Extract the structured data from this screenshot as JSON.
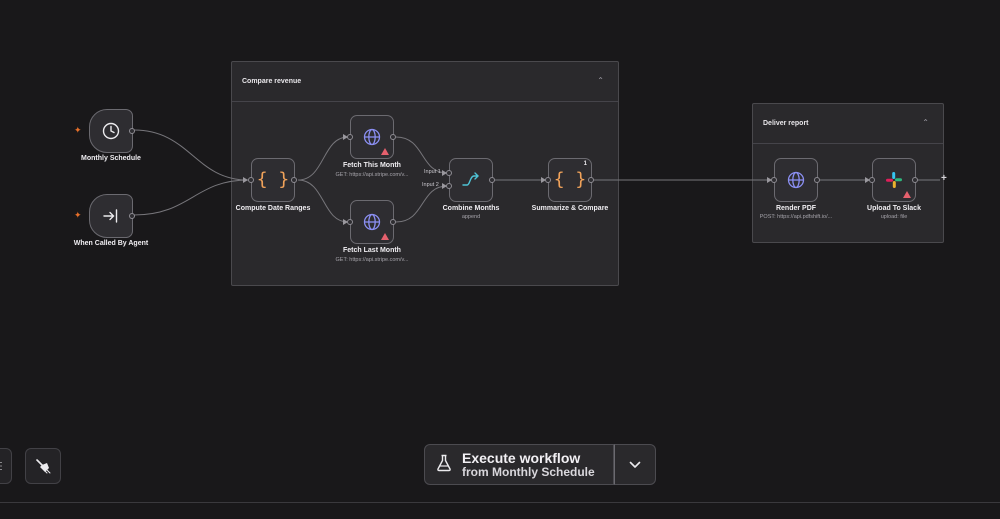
{
  "groups": {
    "compare_revenue": {
      "title": "Compare revenue"
    },
    "deliver_report": {
      "title": "Deliver report"
    }
  },
  "nodes": {
    "monthly_schedule": {
      "label": "Monthly Schedule",
      "icon": "clock-icon"
    },
    "when_called_by_agent": {
      "label": "When Called By Agent",
      "icon": "enter-arrow-icon"
    },
    "compute_date_ranges": {
      "label": "Compute Date Ranges",
      "icon": "code-braces-icon"
    },
    "fetch_this_month": {
      "label": "Fetch This Month",
      "subtitle": "GET: https://api.stripe.com/v...",
      "icon": "globe-icon"
    },
    "fetch_last_month": {
      "label": "Fetch Last Month",
      "subtitle": "GET: https://api.stripe.com/v...",
      "icon": "globe-icon"
    },
    "combine_months": {
      "label": "Combine Months",
      "subtitle": "append",
      "icon": "merge-icon",
      "input_1": "Input 1",
      "input_2": "Input 2"
    },
    "summarize_compare": {
      "label": "Summarize & Compare",
      "icon": "code-braces-icon",
      "badge": "1"
    },
    "render_pdf": {
      "label": "Render PDF",
      "subtitle": "POST: https://api.pdfshift.io/...",
      "icon": "globe-icon"
    },
    "upload_to_slack": {
      "label": "Upload To Slack",
      "subtitle": "upload: file",
      "icon": "slack-icon"
    }
  },
  "toolbar": {
    "execute_title": "Execute workflow",
    "execute_subtitle": "from Monthly Schedule"
  },
  "colors": {
    "background": "#19181a",
    "trigger_bolt": "#e8702a",
    "warning": "#e5606d",
    "globe": "#8b8ff2",
    "code": "#f0a25a",
    "merge": "#4fc3d6"
  }
}
